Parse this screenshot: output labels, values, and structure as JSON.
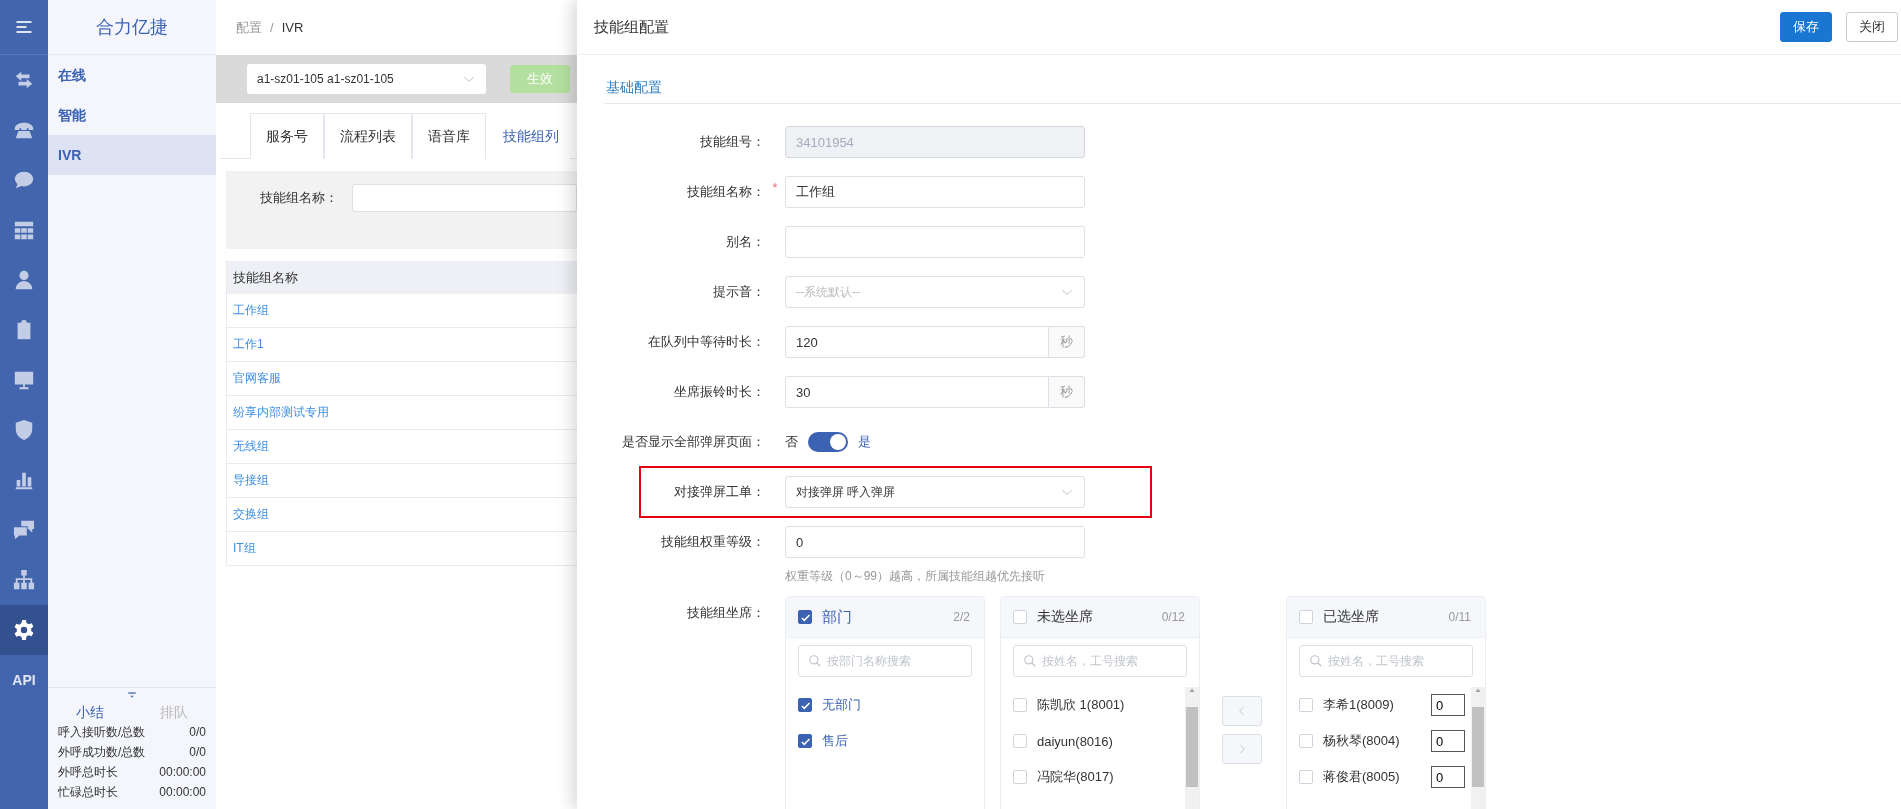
{
  "sidebar": {
    "items": [
      {
        "kind": "menu",
        "selected": false
      },
      {
        "kind": "swap",
        "selected": false
      },
      {
        "kind": "phone",
        "selected": false
      },
      {
        "kind": "chat",
        "selected": false
      },
      {
        "kind": "grid",
        "selected": false
      },
      {
        "kind": "person",
        "selected": false
      },
      {
        "kind": "clipboard",
        "selected": false
      },
      {
        "kind": "monitor",
        "selected": false
      },
      {
        "kind": "shield",
        "selected": false
      },
      {
        "kind": "chart",
        "selected": false
      },
      {
        "kind": "bubbles",
        "selected": false
      },
      {
        "kind": "org",
        "selected": false
      },
      {
        "kind": "gear",
        "selected": true
      },
      {
        "kind": "text",
        "label": "API",
        "selected": false
      }
    ]
  },
  "nav": {
    "brand": "合力亿捷",
    "items": [
      {
        "label": "在线",
        "selected": false
      },
      {
        "label": "智能",
        "selected": false
      },
      {
        "label": "IVR",
        "selected": true
      }
    ]
  },
  "summary": {
    "tabs": [
      {
        "label": "小结",
        "selected": true
      },
      {
        "label": "排队",
        "selected": false
      }
    ],
    "stats": [
      {
        "label": "呼入接听数/总数",
        "value": "0/0"
      },
      {
        "label": "外呼成功数/总数",
        "value": "0/0"
      },
      {
        "label": "外呼总时长",
        "value": "00:00:00"
      },
      {
        "label": "忙碌总时长",
        "value": "00:00:00"
      }
    ]
  },
  "breadcrumb": {
    "items": [
      "配置",
      "IVR"
    ],
    "separator": "/"
  },
  "toolbar": {
    "select_value": "a1-sz01-105 a1-sz01-105",
    "apply_button": "生效"
  },
  "tabs": [
    {
      "label": "服务号",
      "selected": false
    },
    {
      "label": "流程列表",
      "selected": false
    },
    {
      "label": "语音库",
      "selected": false
    },
    {
      "label": "技能组列",
      "selected": true
    }
  ],
  "search": {
    "label": "技能组名称："
  },
  "table": {
    "columns": [
      "技能组名称"
    ],
    "rows": [
      [
        "工作组"
      ],
      [
        "工作1"
      ],
      [
        "官网客服"
      ],
      [
        "纷享内部测试专用"
      ],
      [
        "无线组"
      ],
      [
        "导接组"
      ],
      [
        "交换组"
      ],
      [
        "IT组"
      ]
    ]
  },
  "drawer": {
    "title": "技能组配置",
    "buttons": [
      {
        "label": "保存",
        "kind": "primary"
      },
      {
        "label": "关闭",
        "kind": "default"
      }
    ],
    "section": "基础配置",
    "fields": [
      {
        "kind": "input",
        "label": "技能组号：",
        "value": "34101954",
        "disabled": true
      },
      {
        "kind": "input",
        "label": "技能组名称：",
        "value": "工作组",
        "disabled": false,
        "required_mark": "*"
      },
      {
        "kind": "input",
        "label": "别名：",
        "disabled": false
      },
      {
        "kind": "select",
        "label": "提示音：",
        "placeholder": "--系统默认--",
        "highlighted": false
      },
      {
        "kind": "input",
        "label": "在队列中等待时长：",
        "value": "120",
        "suffix": "秒",
        "disabled": false
      },
      {
        "kind": "input",
        "label": "坐席振铃时长：",
        "value": "30",
        "suffix": "秒",
        "disabled": false
      },
      {
        "kind": "switch",
        "label": "是否显示全部弹屏页面：",
        "off_label": "否",
        "on_label": "是",
        "on": true
      },
      {
        "kind": "select",
        "label": "对接弹屏工单：",
        "value": "对接弹屏 呼入弹屏",
        "highlighted": true
      },
      {
        "kind": "input",
        "label": "技能组权重等级：",
        "value": "0",
        "hint": "权重等级（0～99）越高，所属技能组越优先接听",
        "disabled": false
      },
      {
        "kind": "transfer",
        "label": "技能组坐席：",
        "panels": [
          {
            "kind": "department",
            "title": "部门",
            "count": "2/2",
            "checked": true,
            "placeholder": "按部门名称搜索",
            "items": [
              {
                "label": "无部门",
                "checked": true
              },
              {
                "label": "售后",
                "checked": true
              }
            ]
          },
          {
            "kind": "agents",
            "title": "未选坐席",
            "count": "0/12",
            "checked": false,
            "placeholder": "按姓名，工号搜索",
            "items": [
              {
                "label": "陈凯欣 1(8001)",
                "checked": false
              },
              {
                "label": "daiyun(8016)",
                "checked": false
              },
              {
                "label": "冯院华(8017)",
                "checked": false
              }
            ]
          },
          {
            "kind": "weighted",
            "title": "已选坐席",
            "count": "0/11",
            "checked": false,
            "placeholder": "按姓名，工号搜索",
            "items": [
              {
                "label": "李希1(8009)",
                "checked": false,
                "weight": "0"
              },
              {
                "label": "杨秋琴(8004)",
                "checked": false,
                "weight": "0"
              },
              {
                "label": "蒋俊君(8005)",
                "checked": false,
                "weight": "0"
              }
            ]
          }
        ],
        "moves": [
          {
            "kind": "left",
            "disabled": true
          },
          {
            "kind": "right",
            "disabled": true
          }
        ]
      }
    ]
  }
}
